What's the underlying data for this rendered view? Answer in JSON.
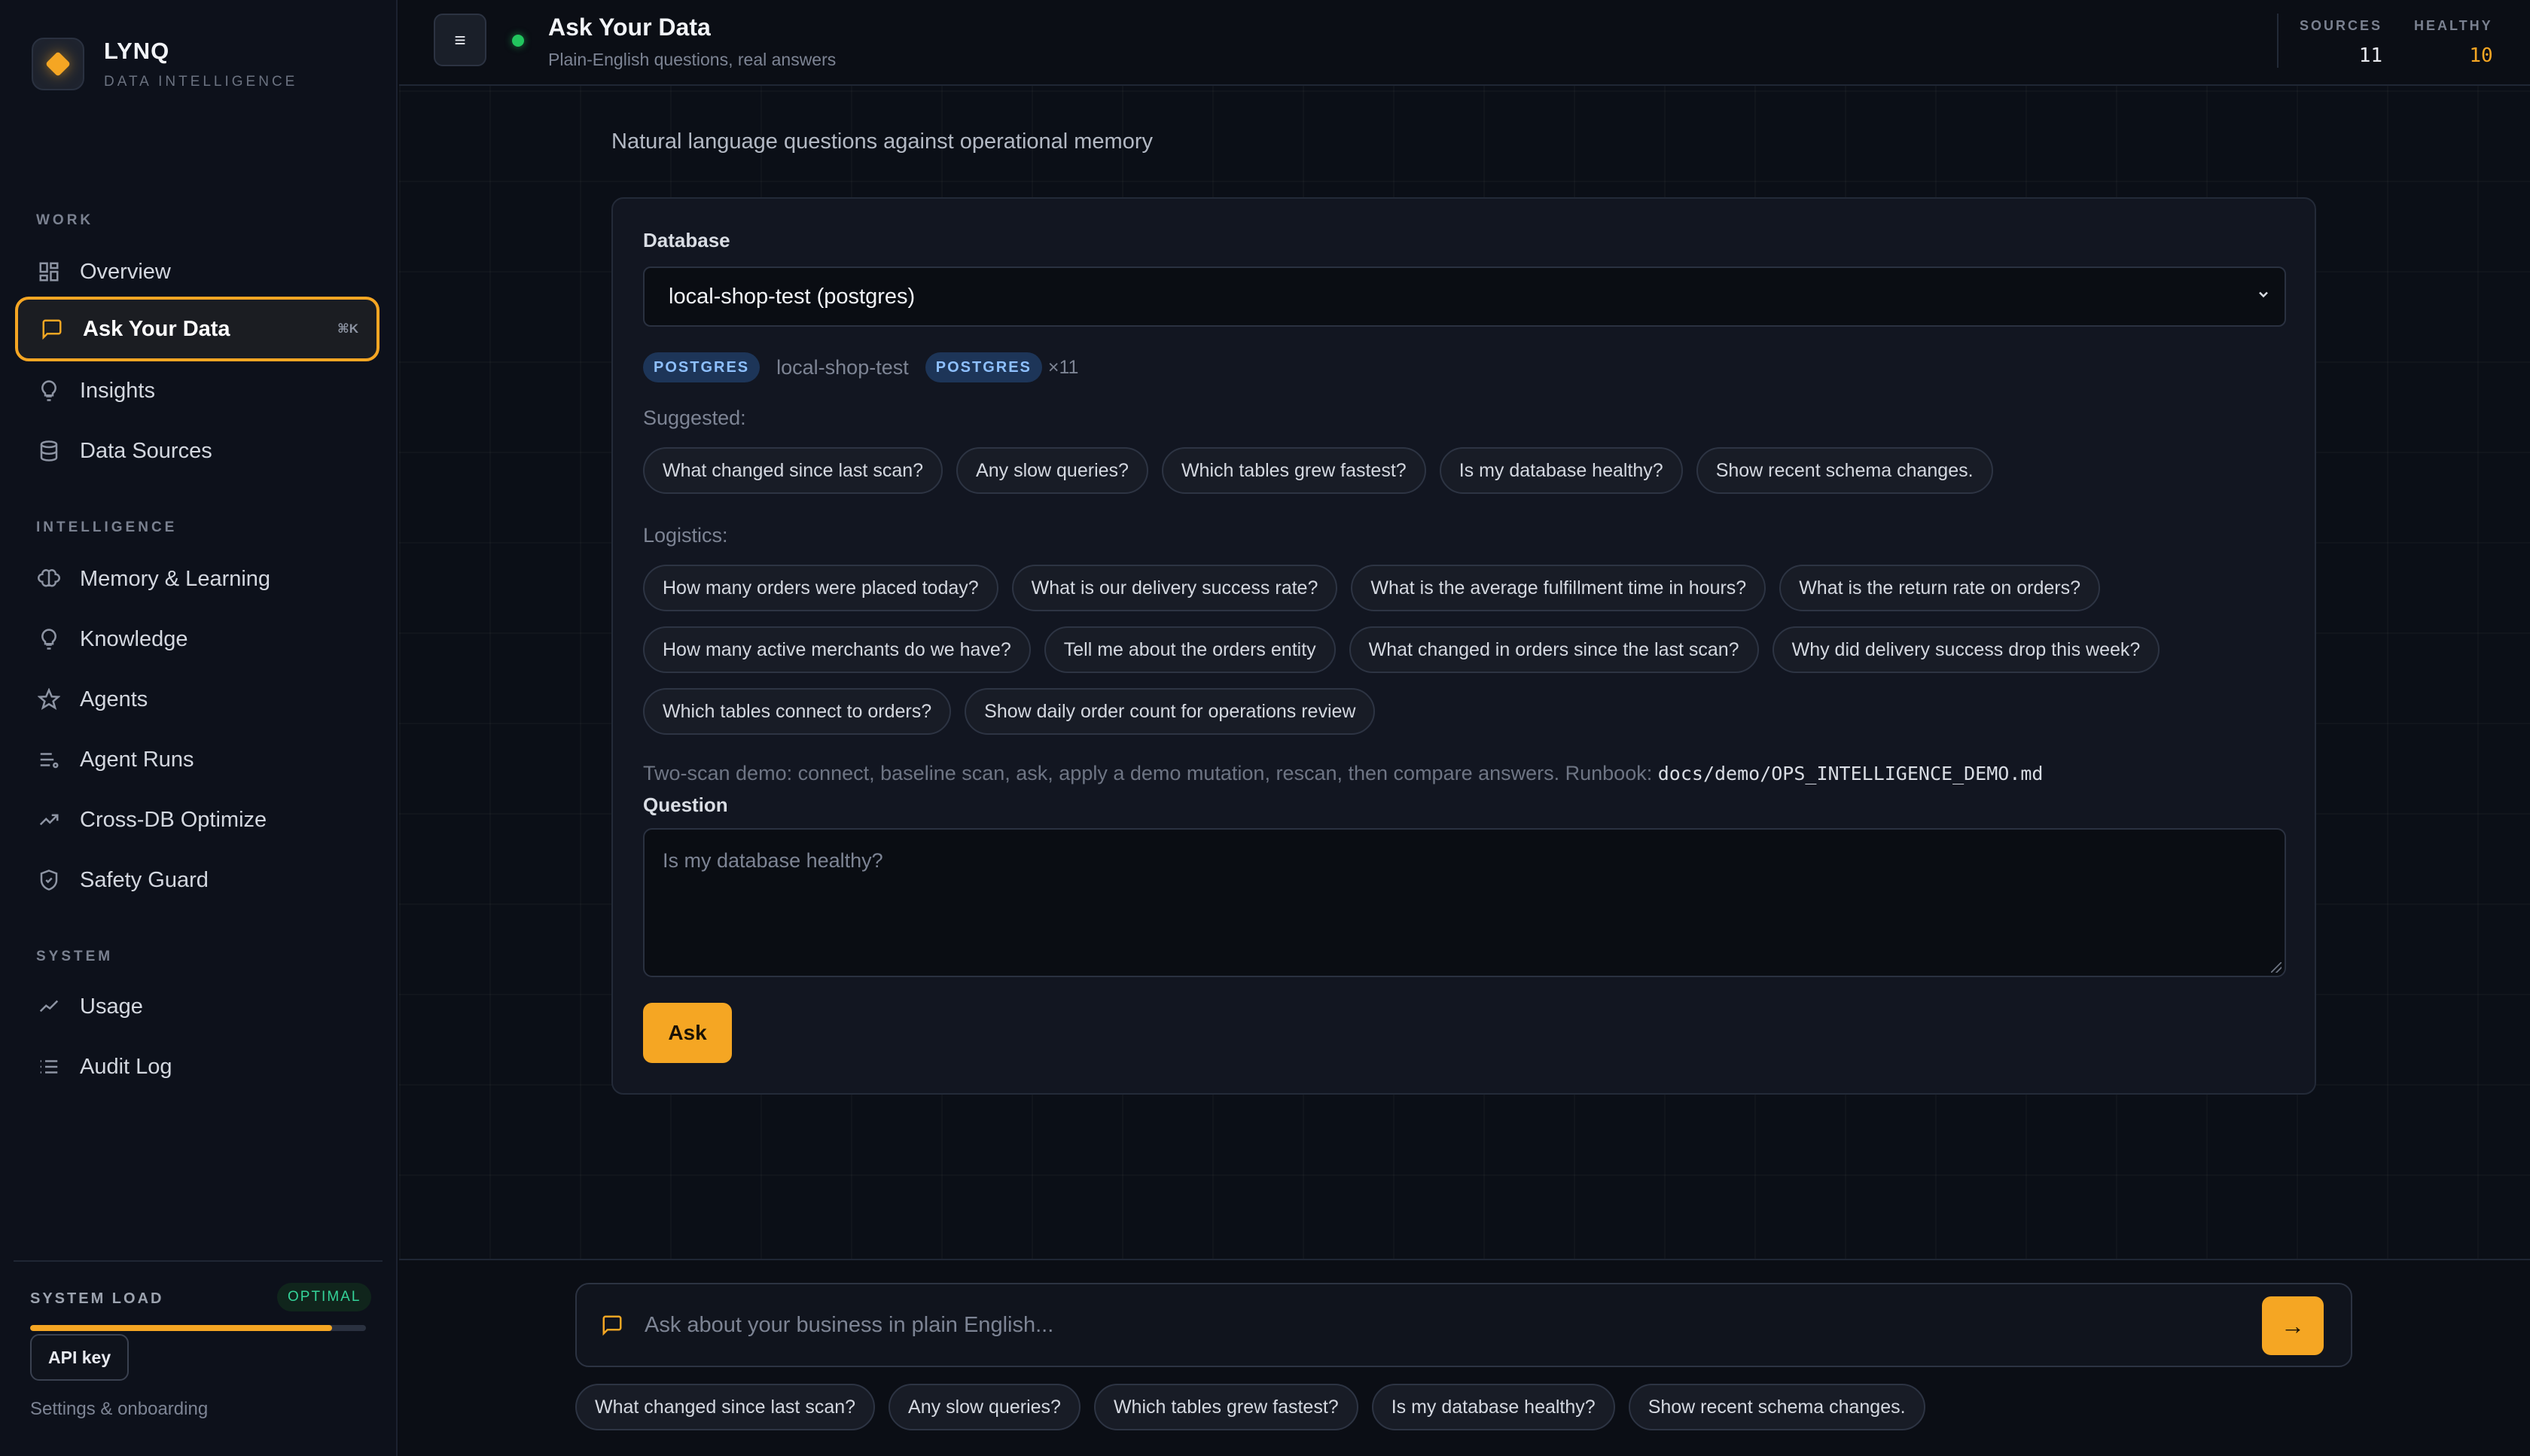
{
  "brand": {
    "name": "LYNQ",
    "subtitle": "DATA INTELLIGENCE",
    "accent": "#f5a623"
  },
  "sidebar": {
    "sections": {
      "work": "WORK",
      "intelligence": "INTELLIGENCE",
      "system": "SYSTEM"
    },
    "items": {
      "overview": "Overview",
      "ask": "Ask Your Data",
      "ask_shortcut": "⌘K",
      "insights": "Insights",
      "sources": "Data Sources",
      "memory": "Memory & Learning",
      "knowledge": "Knowledge",
      "agents": "Agents",
      "agent_runs": "Agent Runs",
      "crossdb": "Cross-DB Optimize",
      "safety": "Safety Guard",
      "usage": "Usage",
      "audit": "Audit Log"
    },
    "system_load": {
      "label": "SYSTEM LOAD",
      "status": "OPTIMAL",
      "level_percent": 90
    },
    "api_key": "API key",
    "settings": "Settings & onboarding"
  },
  "header": {
    "menu_icon": "≡",
    "title": "Ask Your Data",
    "subtitle": "Plain-English questions, real answers",
    "stats": {
      "sources_label": "SOURCES",
      "sources_value": "11",
      "healthy_label": "HEALTHY",
      "healthy_value": "10"
    }
  },
  "main": {
    "intro": "Natural language questions against operational memory",
    "database_label": "Database",
    "database_selected": "local-shop-test (postgres)",
    "tags": {
      "engine_badge": "POSTGRES",
      "db_name": "local-shop-test",
      "engine_badge_2": "POSTGRES",
      "count": "×11"
    },
    "suggested_label": "Suggested:",
    "suggested": [
      "What changed since last scan?",
      "Any slow queries?",
      "Which tables grew fastest?",
      "Is my database healthy?",
      "Show recent schema changes."
    ],
    "logistics_label": "Logistics:",
    "logistics": [
      "How many orders were placed today?",
      "What is our delivery success rate?",
      "What is the average fulfillment time in hours?",
      "What is the return rate on orders?",
      "How many active merchants do we have?",
      "Tell me about the orders entity",
      "What changed in orders since the last scan?",
      "Why did delivery success drop this week?",
      "Which tables connect to orders?",
      "Show daily order count for operations review"
    ],
    "demo_text": "Two-scan demo: connect, baseline scan, ask, apply a demo mutation, rescan, then compare answers. Runbook: ",
    "demo_path": "docs/demo/OPS_INTELLIGENCE_DEMO.md",
    "question_label": "Question",
    "question_placeholder": "Is my database healthy?",
    "ask_button": "Ask"
  },
  "chat": {
    "placeholder": "Ask about your business in plain English...",
    "send_icon": "→",
    "quick": [
      "What changed since last scan?",
      "Any slow queries?",
      "Which tables grew fastest?",
      "Is my database healthy?",
      "Show recent schema changes."
    ]
  }
}
